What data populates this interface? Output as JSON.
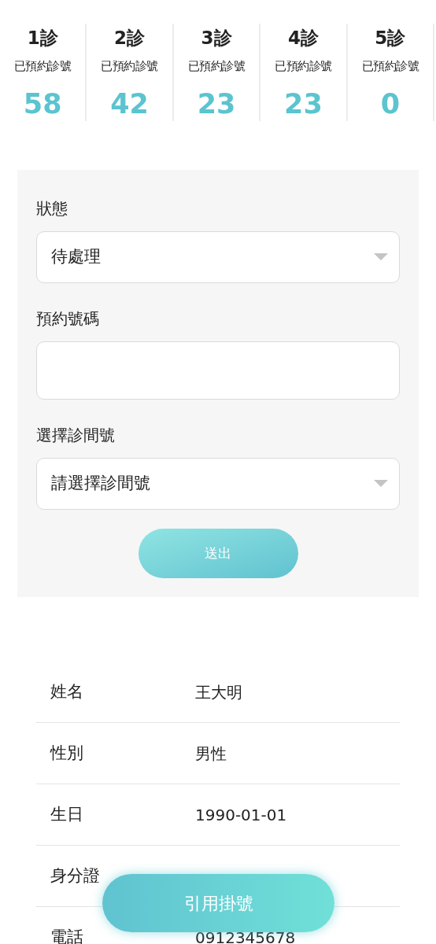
{
  "clinics": [
    {
      "title": "1診",
      "subtitle": "已預約診號",
      "count": "58"
    },
    {
      "title": "2診",
      "subtitle": "已預約診號",
      "count": "42"
    },
    {
      "title": "3診",
      "subtitle": "已預約診號",
      "count": "23"
    },
    {
      "title": "4診",
      "subtitle": "已預約診號",
      "count": "23"
    },
    {
      "title": "5診",
      "subtitle": "已預約診號",
      "count": "0"
    }
  ],
  "form": {
    "fields": [
      {
        "kind": "select",
        "label": "狀態",
        "value": "待處理"
      },
      {
        "kind": "input",
        "label": "預約號碼"
      },
      {
        "kind": "select",
        "label": "選擇診間號",
        "value": "請選擇診間號"
      }
    ],
    "submit": "送出"
  },
  "patient": [
    {
      "label": "姓名",
      "value": "王大明"
    },
    {
      "label": "性別",
      "value": "男性"
    },
    {
      "label": "生日",
      "value": "1990-01-01"
    },
    {
      "label": "身分證"
    },
    {
      "label": "電話",
      "value": "0912345678"
    }
  ],
  "floating_button": "引用掛號"
}
